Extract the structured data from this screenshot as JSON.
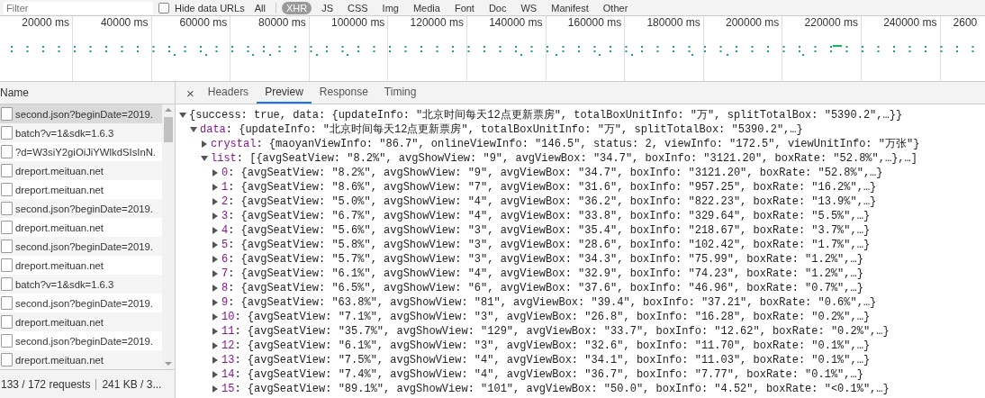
{
  "toolbar": {
    "filter": {
      "placeholder": "Filter"
    },
    "hide_data_urls": {
      "label": "Hide data URLs",
      "checked": false
    },
    "type_filters": [
      {
        "label": "All",
        "selected": false
      },
      {
        "label": "XHR",
        "selected": true
      },
      {
        "label": "JS",
        "selected": false
      },
      {
        "label": "CSS",
        "selected": false
      },
      {
        "label": "Img",
        "selected": false
      },
      {
        "label": "Media",
        "selected": false
      },
      {
        "label": "Font",
        "selected": false
      },
      {
        "label": "Doc",
        "selected": false
      },
      {
        "label": "WS",
        "selected": false
      },
      {
        "label": "Manifest",
        "selected": false
      },
      {
        "label": "Other",
        "selected": false
      }
    ]
  },
  "timeline": {
    "ticks": [
      "20000 ms",
      "40000 ms",
      "60000 ms",
      "80000 ms",
      "100000 ms",
      "120000 ms",
      "140000 ms",
      "160000 ms",
      "180000 ms",
      "200000 ms",
      "220000 ms",
      "240000 ms",
      "2600"
    ]
  },
  "requests": {
    "column": "Name",
    "rows": [
      {
        "name": "second.json?beginDate=2019.",
        "selected": true
      },
      {
        "name": "batch?v=1&sdk=1.6.3",
        "selected": false
      },
      {
        "name": "?d=W3siY2giOiJiYWlkdSIsInN.",
        "selected": false
      },
      {
        "name": "dreport.meituan.net",
        "selected": false
      },
      {
        "name": "dreport.meituan.net",
        "selected": false
      },
      {
        "name": "second.json?beginDate=2019.",
        "selected": false
      },
      {
        "name": "dreport.meituan.net",
        "selected": false
      },
      {
        "name": "second.json?beginDate=2019.",
        "selected": false
      },
      {
        "name": "dreport.meituan.net",
        "selected": false
      },
      {
        "name": "batch?v=1&sdk=1.6.3",
        "selected": false
      },
      {
        "name": "second.json?beginDate=2019.",
        "selected": false
      },
      {
        "name": "dreport.meituan.net",
        "selected": false
      },
      {
        "name": "second.json?beginDate=2019.",
        "selected": false
      },
      {
        "name": "dreport.meituan.net",
        "selected": false
      }
    ],
    "status": {
      "requests": "133 / 172 requests",
      "transferred": "241 KB / 3..."
    }
  },
  "detail": {
    "close": "×",
    "tabs": [
      {
        "label": "Headers",
        "selected": false
      },
      {
        "label": "Preview",
        "selected": true
      },
      {
        "label": "Response",
        "selected": false
      },
      {
        "label": "Timing",
        "selected": false
      }
    ],
    "tree": [
      {
        "value": "{success: true, data: {updateInfo: \"北京时间每天12点更新票房\", totalBoxUnitInfo: \"万\", splitTotalBox: \"5390.2\",…}}",
        "expanded": true,
        "children": [
          {
            "key": "data",
            "value": ": {updateInfo: \"北京时间每天12点更新票房\", totalBoxUnitInfo: \"万\", splitTotalBox: \"5390.2\",…}",
            "expanded": true,
            "children": [
              {
                "key": "crystal",
                "value": ": {maoyanViewInfo: \"86.7\", onlineViewInfo: \"146.5\", status: 2, viewInfo: \"172.5\", viewUnitInfo: \"万张\"}",
                "expanded": false
              },
              {
                "key": "list",
                "value": ": [{avgSeatView: \"8.2%\", avgShowView: \"9\", avgViewBox: \"34.7\", boxInfo: \"3121.20\", boxRate: \"52.8%\",…},…]",
                "expanded": true,
                "children": [
                  {
                    "key": "0",
                    "value": ": {avgSeatView: \"8.2%\", avgShowView: \"9\", avgViewBox: \"34.7\", boxInfo: \"3121.20\", boxRate: \"52.8%\",…}",
                    "expanded": false
                  },
                  {
                    "key": "1",
                    "value": ": {avgSeatView: \"8.6%\", avgShowView: \"7\", avgViewBox: \"31.6\", boxInfo: \"957.25\", boxRate: \"16.2%\",…}",
                    "expanded": false
                  },
                  {
                    "key": "2",
                    "value": ": {avgSeatView: \"5.0%\", avgShowView: \"4\", avgViewBox: \"36.2\", boxInfo: \"822.23\", boxRate: \"13.9%\",…}",
                    "expanded": false
                  },
                  {
                    "key": "3",
                    "value": ": {avgSeatView: \"6.7%\", avgShowView: \"4\", avgViewBox: \"33.8\", boxInfo: \"329.64\", boxRate: \"5.5%\",…}",
                    "expanded": false
                  },
                  {
                    "key": "4",
                    "value": ": {avgSeatView: \"5.6%\", avgShowView: \"3\", avgViewBox: \"35.4\", boxInfo: \"218.67\", boxRate: \"3.7%\",…}",
                    "expanded": false
                  },
                  {
                    "key": "5",
                    "value": ": {avgSeatView: \"5.8%\", avgShowView: \"3\", avgViewBox: \"28.6\", boxInfo: \"102.42\", boxRate: \"1.7%\",…}",
                    "expanded": false
                  },
                  {
                    "key": "6",
                    "value": ": {avgSeatView: \"5.7%\", avgShowView: \"3\", avgViewBox: \"34.3\", boxInfo: \"75.99\", boxRate: \"1.2%\",…}",
                    "expanded": false
                  },
                  {
                    "key": "7",
                    "value": ": {avgSeatView: \"6.1%\", avgShowView: \"4\", avgViewBox: \"32.9\", boxInfo: \"74.23\", boxRate: \"1.2%\",…}",
                    "expanded": false
                  },
                  {
                    "key": "8",
                    "value": ": {avgSeatView: \"6.5%\", avgShowView: \"6\", avgViewBox: \"37.6\", boxInfo: \"46.96\", boxRate: \"0.7%\",…}",
                    "expanded": false
                  },
                  {
                    "key": "9",
                    "value": ": {avgSeatView: \"63.8%\", avgShowView: \"81\", avgViewBox: \"39.4\", boxInfo: \"37.21\", boxRate: \"0.6%\",…}",
                    "expanded": false
                  },
                  {
                    "key": "10",
                    "value": ": {avgSeatView: \"7.1%\", avgShowView: \"3\", avgViewBox: \"26.8\", boxInfo: \"16.28\", boxRate: \"0.2%\",…}",
                    "expanded": false
                  },
                  {
                    "key": "11",
                    "value": ": {avgSeatView: \"35.7%\", avgShowView: \"129\", avgViewBox: \"33.7\", boxInfo: \"12.62\", boxRate: \"0.2%\",…}",
                    "expanded": false
                  },
                  {
                    "key": "12",
                    "value": ": {avgSeatView: \"6.1%\", avgShowView: \"3\", avgViewBox: \"32.6\", boxInfo: \"11.70\", boxRate: \"0.1%\",…}",
                    "expanded": false
                  },
                  {
                    "key": "13",
                    "value": ": {avgSeatView: \"7.5%\", avgShowView: \"4\", avgViewBox: \"34.1\", boxInfo: \"11.03\", boxRate: \"0.1%\",…}",
                    "expanded": false
                  },
                  {
                    "key": "14",
                    "value": ": {avgSeatView: \"7.4%\", avgShowView: \"4\", avgViewBox: \"36.7\", boxInfo: \"7.77\", boxRate: \"0.1%\",…}",
                    "expanded": false
                  },
                  {
                    "key": "15",
                    "value": ": {avgSeatView: \"89.1%\", avgShowView: \"101\", avgViewBox: \"50.0\", boxInfo: \"4.52\", boxRate: \"<0.1%\",…}",
                    "expanded": false
                  }
                ]
              }
            ]
          }
        ]
      }
    ]
  }
}
